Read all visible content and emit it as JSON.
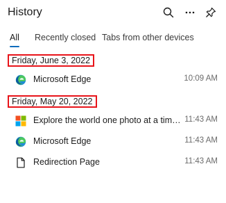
{
  "header": {
    "title": "History",
    "icons": [
      "search-icon",
      "more-icon",
      "pin-icon"
    ]
  },
  "tabs": [
    {
      "label": "All",
      "active": true
    },
    {
      "label": "Recently closed",
      "active": false
    },
    {
      "label": "Tabs from other devices",
      "active": false
    }
  ],
  "groups": [
    {
      "date": "Friday, June 3, 2022",
      "items": [
        {
          "title": "Microsoft Edge",
          "time": "10:09 AM",
          "icon": "edge-icon"
        }
      ]
    },
    {
      "date": "Friday, May 20, 2022",
      "items": [
        {
          "title": "Explore the world one photo at a time | Bin...",
          "time": "11:43 AM",
          "icon": "microsoft-logo-icon"
        },
        {
          "title": "Microsoft Edge",
          "time": "11:43 AM",
          "icon": "edge-icon"
        },
        {
          "title": "Redirection Page",
          "time": "11:43 AM",
          "icon": "page-icon"
        }
      ]
    }
  ],
  "colors": {
    "accent": "#0f6cbd",
    "highlight_border": "#e8141a"
  }
}
